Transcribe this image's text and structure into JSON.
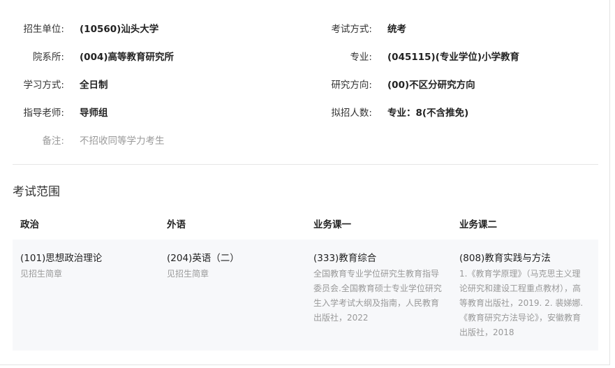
{
  "info": {
    "unit_label": "招生单位:",
    "unit_value": "(10560)汕头大学",
    "exam_method_label": "考试方式:",
    "exam_method_value": "统考",
    "dept_label": "院系所:",
    "dept_value": "(004)高等教育研究所",
    "major_label": "专业:",
    "major_value": "(045115)(专业学位)小学教育",
    "study_mode_label": "学习方式:",
    "study_mode_value": "全日制",
    "direction_label": "研究方向:",
    "direction_value": "(00)不区分研究方向",
    "advisor_label": "指导老师:",
    "advisor_value": "导师组",
    "quota_label": "拟招人数:",
    "quota_value": "专业：8(不含推免)",
    "note_label": "备注:",
    "note_value": "不招收同等学力考生"
  },
  "exam_scope": {
    "title": "考试范围",
    "columns": [
      "政治",
      "外语",
      "业务课一",
      "业务课二"
    ],
    "cells": [
      {
        "course": "(101)思想政治理论",
        "ref_lines": [
          "见招生简章"
        ]
      },
      {
        "course": "(204)英语（二）",
        "ref_lines": [
          "见招生简章"
        ]
      },
      {
        "course": "(333)教育综合",
        "ref_lines": [
          "全国教育专业学位研究生教育指导",
          "委员会.全国教育硕士专业学位研究",
          "生入学考试大纲及指南，人民教育",
          "出版社，2022"
        ]
      },
      {
        "course": "(808)教育实践与方法",
        "ref_lines": [
          "1.《教育学原理》（马克思主义理",
          "论研究和建设工程重点教材），高",
          "等教育出版社，2019. 2. 裴娣娜.",
          "《教育研究方法导论》，安徽教育",
          "出版社，2018"
        ]
      }
    ]
  }
}
